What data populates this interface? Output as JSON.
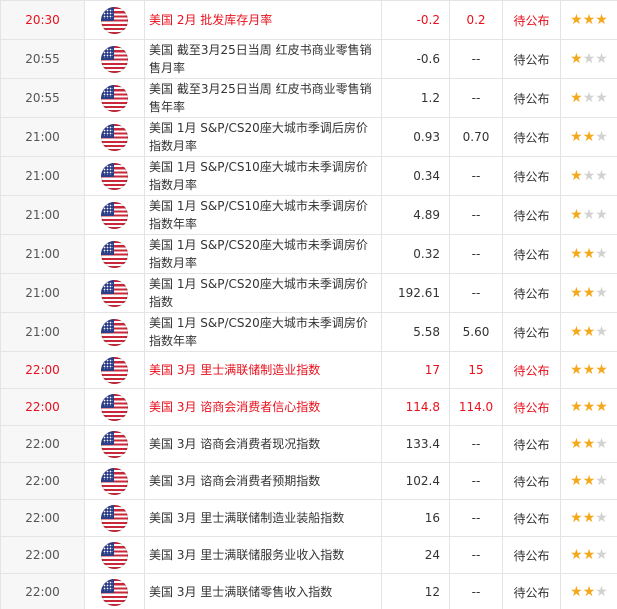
{
  "colors": {
    "highlight": "#e8101c",
    "star_on": "#f4a91c",
    "star_off": "#d2d2d2"
  },
  "flag_icon": "us-flag-icon",
  "rows": [
    {
      "time": "20:30",
      "country": "美国",
      "event": "2月 批发库存月率",
      "previous": "-0.2",
      "forecast": "0.2",
      "actual": "待公布",
      "stars": 3,
      "highlight": true
    },
    {
      "time": "20:55",
      "country": "美国",
      "event": "截至3月25日当周 红皮书商业零售销售月率",
      "previous": "-0.6",
      "forecast": "--",
      "actual": "待公布",
      "stars": 1,
      "highlight": false
    },
    {
      "time": "20:55",
      "country": "美国",
      "event": "截至3月25日当周 红皮书商业零售销售年率",
      "previous": "1.2",
      "forecast": "--",
      "actual": "待公布",
      "stars": 1,
      "highlight": false
    },
    {
      "time": "21:00",
      "country": "美国",
      "event": "1月 S&P/CS20座大城市季调后房价指数月率",
      "previous": "0.93",
      "forecast": "0.70",
      "actual": "待公布",
      "stars": 2,
      "highlight": false
    },
    {
      "time": "21:00",
      "country": "美国",
      "event": "1月 S&P/CS10座大城市未季调房价指数月率",
      "previous": "0.34",
      "forecast": "--",
      "actual": "待公布",
      "stars": 1,
      "highlight": false
    },
    {
      "time": "21:00",
      "country": "美国",
      "event": "1月 S&P/CS10座大城市未季调房价指数年率",
      "previous": "4.89",
      "forecast": "--",
      "actual": "待公布",
      "stars": 1,
      "highlight": false
    },
    {
      "time": "21:00",
      "country": "美国",
      "event": "1月 S&P/CS20座大城市未季调房价指数月率",
      "previous": "0.32",
      "forecast": "--",
      "actual": "待公布",
      "stars": 2,
      "highlight": false
    },
    {
      "time": "21:00",
      "country": "美国",
      "event": "1月 S&P/CS20座大城市未季调房价指数",
      "previous": "192.61",
      "forecast": "--",
      "actual": "待公布",
      "stars": 2,
      "highlight": false
    },
    {
      "time": "21:00",
      "country": "美国",
      "event": "1月 S&P/CS20座大城市未季调房价指数年率",
      "previous": "5.58",
      "forecast": "5.60",
      "actual": "待公布",
      "stars": 2,
      "highlight": false
    },
    {
      "time": "22:00",
      "country": "美国",
      "event": "3月 里士满联储制造业指数",
      "previous": "17",
      "forecast": "15",
      "actual": "待公布",
      "stars": 3,
      "highlight": true
    },
    {
      "time": "22:00",
      "country": "美国",
      "event": "3月 谘商会消费者信心指数",
      "previous": "114.8",
      "forecast": "114.0",
      "actual": "待公布",
      "stars": 3,
      "highlight": true
    },
    {
      "time": "22:00",
      "country": "美国",
      "event": "3月 谘商会消费者现况指数",
      "previous": "133.4",
      "forecast": "--",
      "actual": "待公布",
      "stars": 2,
      "highlight": false
    },
    {
      "time": "22:00",
      "country": "美国",
      "event": "3月 谘商会消费者预期指数",
      "previous": "102.4",
      "forecast": "--",
      "actual": "待公布",
      "stars": 2,
      "highlight": false
    },
    {
      "time": "22:00",
      "country": "美国",
      "event": "3月 里士满联储制造业装船指数",
      "previous": "16",
      "forecast": "--",
      "actual": "待公布",
      "stars": 2,
      "highlight": false
    },
    {
      "time": "22:00",
      "country": "美国",
      "event": "3月 里士满联储服务业收入指数",
      "previous": "24",
      "forecast": "--",
      "actual": "待公布",
      "stars": 2,
      "highlight": false
    },
    {
      "time": "22:00",
      "country": "美国",
      "event": "3月 里士满联储零售收入指数",
      "previous": "12",
      "forecast": "--",
      "actual": "待公布",
      "stars": 2,
      "highlight": false
    }
  ]
}
